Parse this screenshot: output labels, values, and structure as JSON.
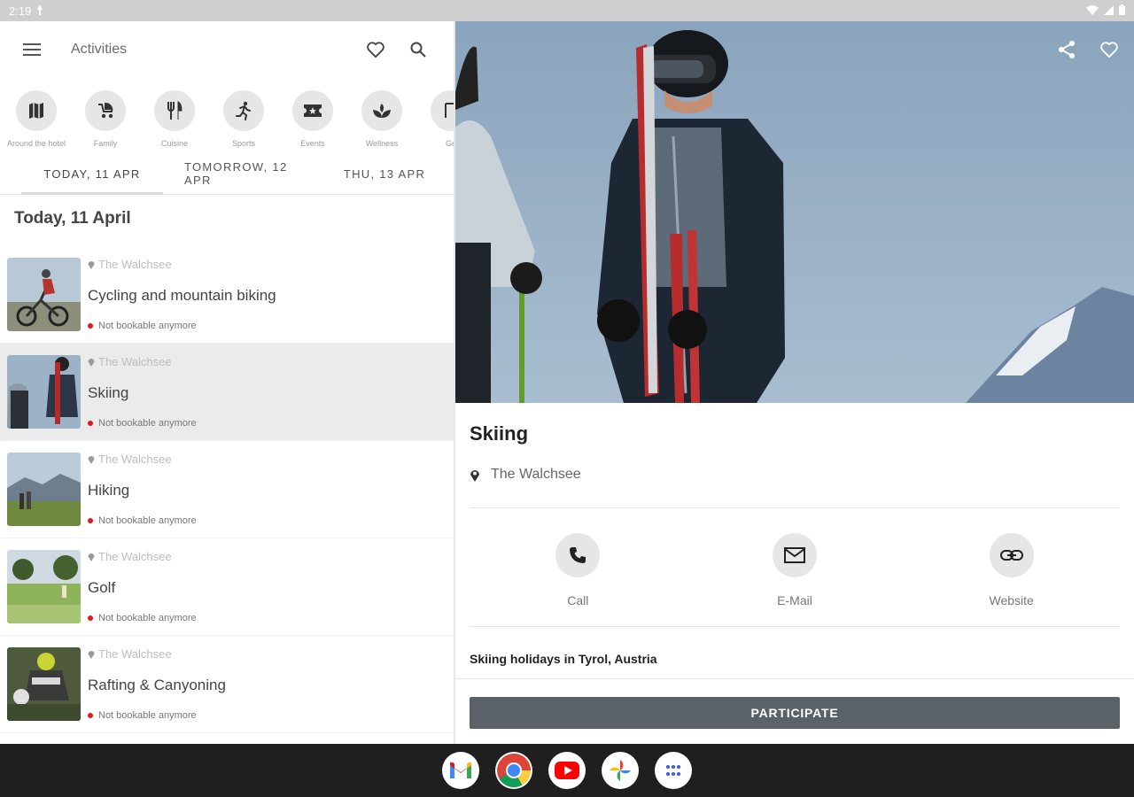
{
  "status_bar": {
    "time": "2:19"
  },
  "header": {
    "title": "Activities"
  },
  "categories": [
    {
      "label": "Around the hotel",
      "icon": "map-icon"
    },
    {
      "label": "Family",
      "icon": "stroller-icon"
    },
    {
      "label": "Cuisine",
      "icon": "cutlery-icon"
    },
    {
      "label": "Sports",
      "icon": "running-icon"
    },
    {
      "label": "Events",
      "icon": "ticket-icon"
    },
    {
      "label": "Wellness",
      "icon": "spa-icon"
    },
    {
      "label": "Ge",
      "icon": "category-icon"
    }
  ],
  "tabs": [
    {
      "label": "TODAY, 11 APR"
    },
    {
      "label": "TOMORROW, 12 APR"
    },
    {
      "label": "THU, 13 APR"
    }
  ],
  "list": {
    "heading": "Today, 11 April",
    "items": [
      {
        "location": "The Walchsee",
        "title": "Cycling and mountain biking",
        "status": "Not bookable anymore"
      },
      {
        "location": "The Walchsee",
        "title": "Skiing",
        "status": "Not bookable anymore"
      },
      {
        "location": "The Walchsee",
        "title": "Hiking",
        "status": "Not bookable anymore"
      },
      {
        "location": "The Walchsee",
        "title": "Golf",
        "status": "Not bookable anymore"
      },
      {
        "location": "The Walchsee",
        "title": "Rafting & Canyoning",
        "status": "Not bookable anymore"
      }
    ]
  },
  "detail": {
    "title": "Skiing",
    "location": "The Walchsee",
    "actions": [
      {
        "label": "Call"
      },
      {
        "label": "E-Mail"
      },
      {
        "label": "Website"
      }
    ],
    "description": "Skiing holidays in Tyrol, Austria",
    "participate_label": "PARTICIPATE"
  },
  "colors": {
    "status_dot": "#e8141b",
    "button": "#5a6169",
    "selected_row": "#ebebeb"
  },
  "dock": [
    "Gmail",
    "Chrome",
    "YouTube",
    "Photos",
    "App launcher"
  ]
}
